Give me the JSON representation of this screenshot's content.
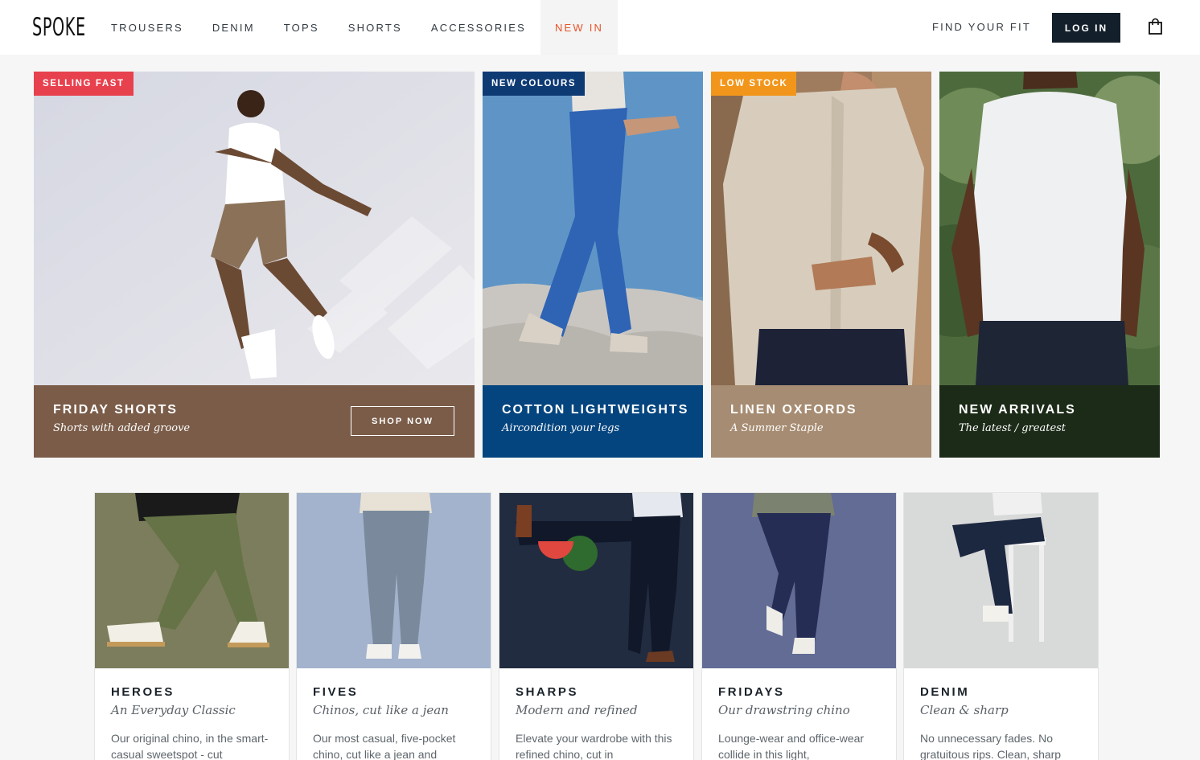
{
  "brand": {
    "logo": "SPOKE"
  },
  "nav": {
    "items": [
      {
        "label": "TROUSERS"
      },
      {
        "label": "DENIM"
      },
      {
        "label": "TOPS"
      },
      {
        "label": "SHORTS"
      },
      {
        "label": "ACCESSORIES"
      },
      {
        "label": "NEW IN",
        "active": true
      }
    ],
    "find_fit": "FIND YOUR FIT",
    "login": "LOG IN",
    "cart_icon": "shopping-bag-icon"
  },
  "colors": {
    "accent_orange": "#e8542c",
    "login_bg": "#13202b",
    "badge_red": "#e8414e",
    "badge_navy": "#0e3a74",
    "badge_orange": "#f2961b",
    "caption_brown": "#7a5c48",
    "caption_blue": "#05457f",
    "caption_tan": "#a68c72",
    "caption_green": "#1c2a18"
  },
  "hero": [
    {
      "badge": "SELLING FAST",
      "title": "FRIDAY SHORTS",
      "subtitle": "Shorts with added groove",
      "button": "SHOP NOW"
    },
    {
      "badge": "NEW COLOURS",
      "title": "COTTON LIGHTWEIGHTS",
      "subtitle": "Aircondition your legs"
    },
    {
      "badge": "LOW STOCK",
      "title": "LINEN OXFORDS",
      "subtitle": "A Summer Staple"
    },
    {
      "title": "NEW ARRIVALS",
      "subtitle": "The latest / greatest"
    }
  ],
  "products": [
    {
      "name": "HEROES",
      "tagline": "An Everyday Classic",
      "desc": "Our original chino, in the smart-casual sweetspot - cut"
    },
    {
      "name": "FIVES",
      "tagline": "Chinos, cut like a jean",
      "desc": "Our most casual, five-pocket chino, cut like a jean and"
    },
    {
      "name": "SHARPS",
      "tagline": "Modern and refined",
      "desc": "Elevate your wardrobe with this refined chino, cut in"
    },
    {
      "name": "FRIDAYS",
      "tagline": "Our drawstring chino",
      "desc": "Lounge-wear and office-wear collide in this light,"
    },
    {
      "name": "DENIM",
      "tagline": "Clean & sharp",
      "desc": "No unnecessary fades. No gratuitous rips. Clean, sharp"
    }
  ]
}
